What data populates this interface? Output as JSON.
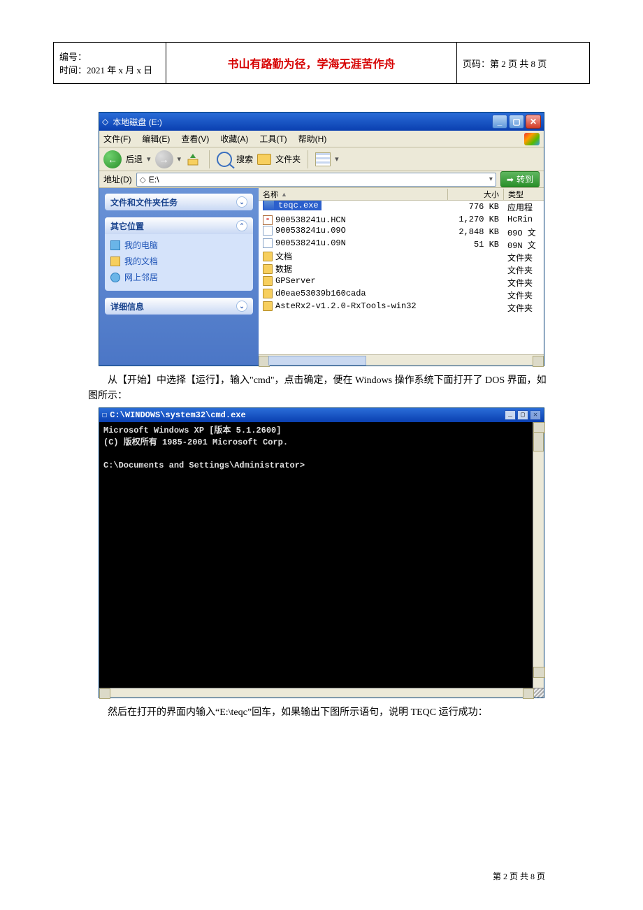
{
  "header": {
    "serial_label": "编号：",
    "date_label": "时间：2021 年 x 月 x 日",
    "motto": "书山有路勤为径，学海无涯苦作舟",
    "pager": "页码：第 2 页  共 8 页"
  },
  "explorer": {
    "title_prefix": "◇",
    "title": "本地磁盘 (E:)",
    "menu": {
      "file": "文件(F)",
      "edit": "编辑(E)",
      "view": "查看(V)",
      "favorites": "收藏(A)",
      "tools": "工具(T)",
      "help": "帮助(H)"
    },
    "toolbar": {
      "back": "后退",
      "search": "搜索",
      "folders": "文件夹"
    },
    "addr_label": "地址(D)",
    "addr_value": "E:\\",
    "go_label": "转到",
    "side_panes": {
      "tasks": "文件和文件夹任务",
      "other": "其它位置",
      "other_items": [
        "我的电脑",
        "我的文档",
        "网上邻居"
      ],
      "details": "详细信息"
    },
    "columns": {
      "name": "名称",
      "arrow": "▲",
      "size": "大小",
      "type": "类型"
    },
    "rows": [
      {
        "icon": "exe",
        "name": "teqc.exe",
        "size": "776 KB",
        "type": "应用程",
        "selected": true
      },
      {
        "icon": "hcn",
        "name": "900538241u.HCN",
        "size": "1,270 KB",
        "type": "HcRin"
      },
      {
        "icon": "o",
        "name": "900538241u.09O",
        "size": "2,848 KB",
        "type": "09O 文"
      },
      {
        "icon": "o",
        "name": "900538241u.09N",
        "size": "51 KB",
        "type": "09N 文"
      },
      {
        "icon": "fld",
        "name": "文档",
        "size": "",
        "type": "文件夹"
      },
      {
        "icon": "fld",
        "name": "数据",
        "size": "",
        "type": "文件夹"
      },
      {
        "icon": "fld",
        "name": "GPServer",
        "size": "",
        "type": "文件夹"
      },
      {
        "icon": "fld",
        "name": "d0eae53039b160cada",
        "size": "",
        "type": "文件夹"
      },
      {
        "icon": "fld",
        "name": "AsteRx2-v1.2.0-RxTools-win32",
        "size": "",
        "type": "文件夹"
      }
    ]
  },
  "para1": "从【开始】中选择【运行】，输入\"cmd\"，点击确定，便在 Windows 操作系统下面打开了 DOS 界面，如图所示：",
  "cmd": {
    "title_prefix": "☐",
    "title": "C:\\WINDOWS\\system32\\cmd.exe",
    "line1": "Microsoft Windows XP [版本 5.1.2600]",
    "line2": "(C) 版权所有 1985-2001 Microsoft Corp.",
    "prompt": "C:\\Documents and Settings\\Administrator>"
  },
  "para2": "然后在打开的界面内输入“E:\\teqc”回车，如果输出下图所示语句，说明 TEQC 运行成功：",
  "footer": "第 2 页 共 8 页"
}
